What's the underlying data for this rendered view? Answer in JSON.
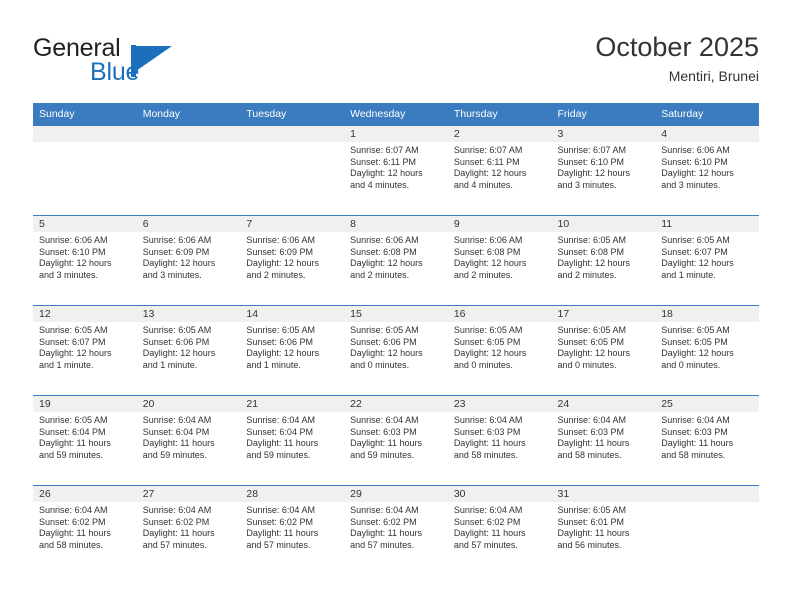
{
  "brand": {
    "name_line1": "General",
    "name_line2": "Blue",
    "flag_icon": "blue-flag-triangle",
    "color_dark": "#231f20",
    "color_blue": "#1c6fba"
  },
  "header": {
    "month_title": "October 2025",
    "location": "Mentiri, Brunei"
  },
  "theme": {
    "header_blue": "#3b7cc0",
    "daynum_band": "#f0f0f0",
    "text": "#333333"
  },
  "calendar": {
    "weekday_headers": [
      "Sunday",
      "Monday",
      "Tuesday",
      "Wednesday",
      "Thursday",
      "Friday",
      "Saturday"
    ],
    "weeks": [
      [
        {
          "day": "",
          "lines": []
        },
        {
          "day": "",
          "lines": []
        },
        {
          "day": "",
          "lines": []
        },
        {
          "day": "1",
          "lines": [
            "Sunrise: 6:07 AM",
            "Sunset: 6:11 PM",
            "Daylight: 12 hours",
            "and 4 minutes."
          ]
        },
        {
          "day": "2",
          "lines": [
            "Sunrise: 6:07 AM",
            "Sunset: 6:11 PM",
            "Daylight: 12 hours",
            "and 4 minutes."
          ]
        },
        {
          "day": "3",
          "lines": [
            "Sunrise: 6:07 AM",
            "Sunset: 6:10 PM",
            "Daylight: 12 hours",
            "and 3 minutes."
          ]
        },
        {
          "day": "4",
          "lines": [
            "Sunrise: 6:06 AM",
            "Sunset: 6:10 PM",
            "Daylight: 12 hours",
            "and 3 minutes."
          ]
        }
      ],
      [
        {
          "day": "5",
          "lines": [
            "Sunrise: 6:06 AM",
            "Sunset: 6:10 PM",
            "Daylight: 12 hours",
            "and 3 minutes."
          ]
        },
        {
          "day": "6",
          "lines": [
            "Sunrise: 6:06 AM",
            "Sunset: 6:09 PM",
            "Daylight: 12 hours",
            "and 3 minutes."
          ]
        },
        {
          "day": "7",
          "lines": [
            "Sunrise: 6:06 AM",
            "Sunset: 6:09 PM",
            "Daylight: 12 hours",
            "and 2 minutes."
          ]
        },
        {
          "day": "8",
          "lines": [
            "Sunrise: 6:06 AM",
            "Sunset: 6:08 PM",
            "Daylight: 12 hours",
            "and 2 minutes."
          ]
        },
        {
          "day": "9",
          "lines": [
            "Sunrise: 6:06 AM",
            "Sunset: 6:08 PM",
            "Daylight: 12 hours",
            "and 2 minutes."
          ]
        },
        {
          "day": "10",
          "lines": [
            "Sunrise: 6:05 AM",
            "Sunset: 6:08 PM",
            "Daylight: 12 hours",
            "and 2 minutes."
          ]
        },
        {
          "day": "11",
          "lines": [
            "Sunrise: 6:05 AM",
            "Sunset: 6:07 PM",
            "Daylight: 12 hours",
            "and 1 minute."
          ]
        }
      ],
      [
        {
          "day": "12",
          "lines": [
            "Sunrise: 6:05 AM",
            "Sunset: 6:07 PM",
            "Daylight: 12 hours",
            "and 1 minute."
          ]
        },
        {
          "day": "13",
          "lines": [
            "Sunrise: 6:05 AM",
            "Sunset: 6:06 PM",
            "Daylight: 12 hours",
            "and 1 minute."
          ]
        },
        {
          "day": "14",
          "lines": [
            "Sunrise: 6:05 AM",
            "Sunset: 6:06 PM",
            "Daylight: 12 hours",
            "and 1 minute."
          ]
        },
        {
          "day": "15",
          "lines": [
            "Sunrise: 6:05 AM",
            "Sunset: 6:06 PM",
            "Daylight: 12 hours",
            "and 0 minutes."
          ]
        },
        {
          "day": "16",
          "lines": [
            "Sunrise: 6:05 AM",
            "Sunset: 6:05 PM",
            "Daylight: 12 hours",
            "and 0 minutes."
          ]
        },
        {
          "day": "17",
          "lines": [
            "Sunrise: 6:05 AM",
            "Sunset: 6:05 PM",
            "Daylight: 12 hours",
            "and 0 minutes."
          ]
        },
        {
          "day": "18",
          "lines": [
            "Sunrise: 6:05 AM",
            "Sunset: 6:05 PM",
            "Daylight: 12 hours",
            "and 0 minutes."
          ]
        }
      ],
      [
        {
          "day": "19",
          "lines": [
            "Sunrise: 6:05 AM",
            "Sunset: 6:04 PM",
            "Daylight: 11 hours",
            "and 59 minutes."
          ]
        },
        {
          "day": "20",
          "lines": [
            "Sunrise: 6:04 AM",
            "Sunset: 6:04 PM",
            "Daylight: 11 hours",
            "and 59 minutes."
          ]
        },
        {
          "day": "21",
          "lines": [
            "Sunrise: 6:04 AM",
            "Sunset: 6:04 PM",
            "Daylight: 11 hours",
            "and 59 minutes."
          ]
        },
        {
          "day": "22",
          "lines": [
            "Sunrise: 6:04 AM",
            "Sunset: 6:03 PM",
            "Daylight: 11 hours",
            "and 59 minutes."
          ]
        },
        {
          "day": "23",
          "lines": [
            "Sunrise: 6:04 AM",
            "Sunset: 6:03 PM",
            "Daylight: 11 hours",
            "and 58 minutes."
          ]
        },
        {
          "day": "24",
          "lines": [
            "Sunrise: 6:04 AM",
            "Sunset: 6:03 PM",
            "Daylight: 11 hours",
            "and 58 minutes."
          ]
        },
        {
          "day": "25",
          "lines": [
            "Sunrise: 6:04 AM",
            "Sunset: 6:03 PM",
            "Daylight: 11 hours",
            "and 58 minutes."
          ]
        }
      ],
      [
        {
          "day": "26",
          "lines": [
            "Sunrise: 6:04 AM",
            "Sunset: 6:02 PM",
            "Daylight: 11 hours",
            "and 58 minutes."
          ]
        },
        {
          "day": "27",
          "lines": [
            "Sunrise: 6:04 AM",
            "Sunset: 6:02 PM",
            "Daylight: 11 hours",
            "and 57 minutes."
          ]
        },
        {
          "day": "28",
          "lines": [
            "Sunrise: 6:04 AM",
            "Sunset: 6:02 PM",
            "Daylight: 11 hours",
            "and 57 minutes."
          ]
        },
        {
          "day": "29",
          "lines": [
            "Sunrise: 6:04 AM",
            "Sunset: 6:02 PM",
            "Daylight: 11 hours",
            "and 57 minutes."
          ]
        },
        {
          "day": "30",
          "lines": [
            "Sunrise: 6:04 AM",
            "Sunset: 6:02 PM",
            "Daylight: 11 hours",
            "and 57 minutes."
          ]
        },
        {
          "day": "31",
          "lines": [
            "Sunrise: 6:05 AM",
            "Sunset: 6:01 PM",
            "Daylight: 11 hours",
            "and 56 minutes."
          ]
        },
        {
          "day": "",
          "lines": []
        }
      ]
    ]
  }
}
